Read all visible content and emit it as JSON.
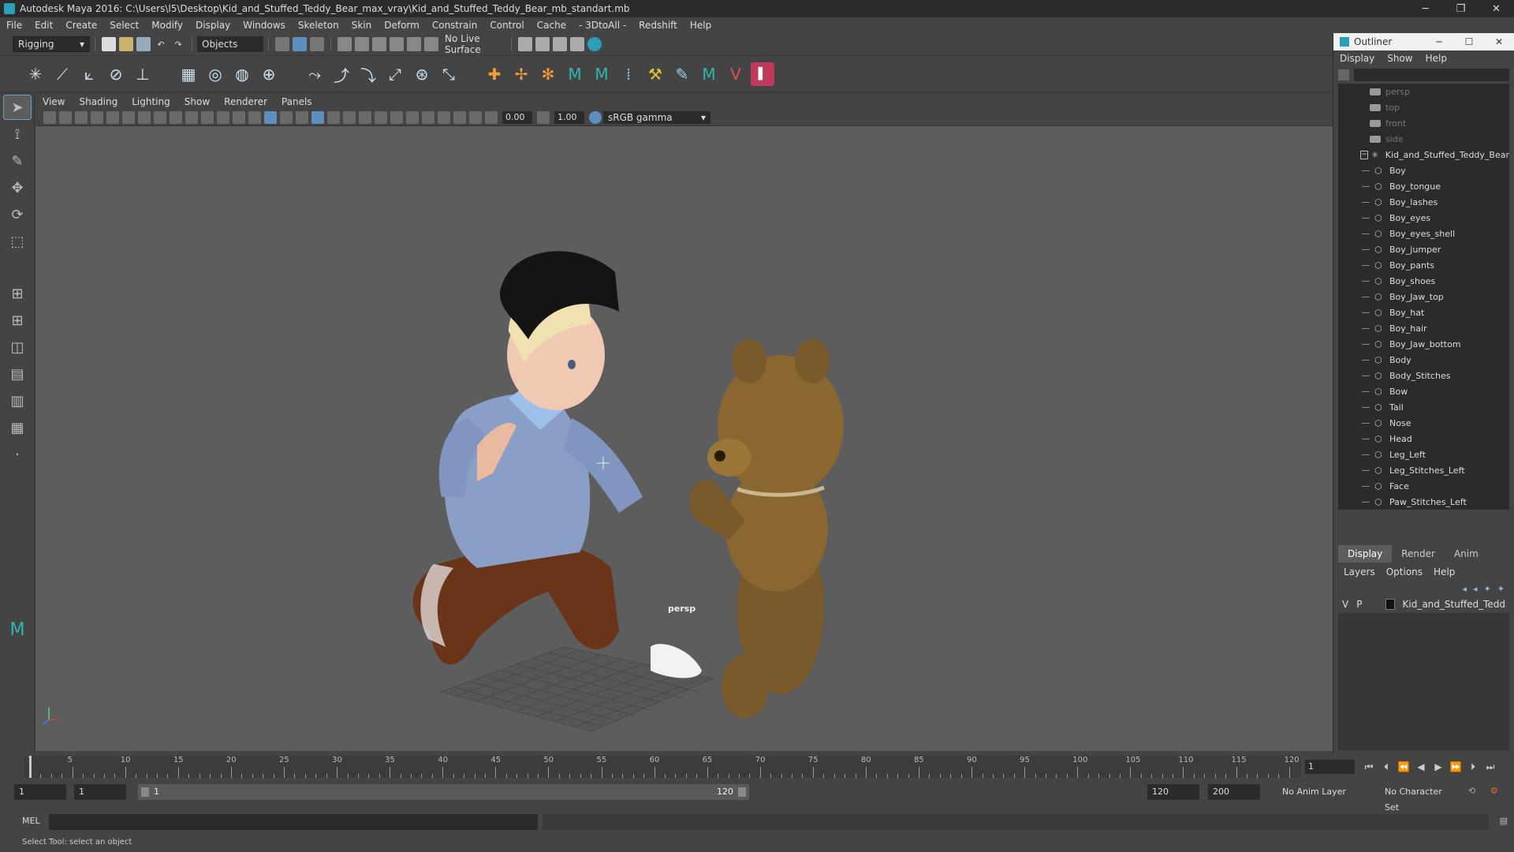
{
  "window": {
    "title": "Autodesk Maya 2016: C:\\Users\\l5\\Desktop\\Kid_and_Stuffed_Teddy_Bear_max_vray\\Kid_and_Stuffed_Teddy_Bear_mb_standart.mb"
  },
  "menubar": [
    "File",
    "Edit",
    "Create",
    "Select",
    "Modify",
    "Display",
    "Windows",
    "Skeleton",
    "Skin",
    "Deform",
    "Constrain",
    "Control",
    "Cache",
    "- 3DtoAll -",
    "Redshift",
    "Help"
  ],
  "statusline": {
    "mode": "Rigging",
    "selection_mode": "Objects",
    "live_surface": "No Live Surface"
  },
  "viewport": {
    "menu": [
      "View",
      "Shading",
      "Lighting",
      "Show",
      "Renderer",
      "Panels"
    ],
    "exposure": "0.00",
    "gamma": "1.00",
    "color_space": "sRGB gamma",
    "camera_label": "persp"
  },
  "outliner": {
    "title": "Outliner",
    "menu": [
      "Display",
      "Show",
      "Help"
    ],
    "cameras": [
      "persp",
      "top",
      "front",
      "side"
    ],
    "root": "Kid_and_Stuffed_Teddy_Bear",
    "items": [
      "Boy",
      "Boy_tongue",
      "Boy_lashes",
      "Boy_eyes",
      "Boy_eyes_shell",
      "Boy_jumper",
      "Boy_pants",
      "Boy_shoes",
      "Boy_Jaw_top",
      "Boy_hat",
      "Boy_hair",
      "Boy_Jaw_bottom",
      "Body",
      "Body_Stitches",
      "Bow",
      "Tail",
      "Nose",
      "Head",
      "Leg_Left",
      "Leg_Stitches_Left",
      "Face",
      "Paw_Stitches_Left"
    ]
  },
  "layer_editor": {
    "tabs": [
      "Display",
      "Render",
      "Anim"
    ],
    "menu": [
      "Layers",
      "Options",
      "Help"
    ],
    "layer": {
      "v": "V",
      "p": "P",
      "name": "Kid_and_Stuffed_Tedd"
    }
  },
  "timeline": {
    "ticks": [
      "5",
      "10",
      "15",
      "20",
      "25",
      "30",
      "35",
      "40",
      "45",
      "50",
      "55",
      "60",
      "65",
      "70",
      "75",
      "80",
      "85",
      "90",
      "95",
      "100",
      "105",
      "110",
      "115",
      "120"
    ],
    "start_tick": "1",
    "current_frame": "1"
  },
  "range": {
    "start": "1",
    "playback_start": "1",
    "slider_lo": "1",
    "slider_hi": "120",
    "playback_end": "120",
    "end": "200",
    "anim_layer": "No Anim Layer",
    "character_set": "No Character Set"
  },
  "cmdline": {
    "lang": "MEL"
  },
  "helpline": {
    "text": "Select Tool: select an object"
  },
  "colors": {
    "accent": "#5c8fbf",
    "panel": "#444444",
    "viewport_bg": "#5d5d5d"
  }
}
